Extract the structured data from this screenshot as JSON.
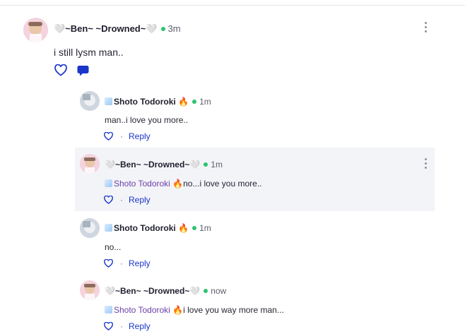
{
  "post": {
    "author": "🤍~Ben~ ~Drowned~🤍",
    "time": "3m",
    "text": "i still lysm man.."
  },
  "replies": [
    {
      "author": "Shoto Todoroki",
      "emoji": "🔥",
      "time": "1m",
      "mention": "",
      "text": "man..i love you more..",
      "reply_label": "Reply"
    },
    {
      "author": "🤍~Ben~ ~Drowned~🤍",
      "emoji": "",
      "time": "1m",
      "mention": "Shoto Todoroki 🔥",
      "text": "no...i love you more..",
      "reply_label": "Reply"
    },
    {
      "author": "Shoto Todoroki",
      "emoji": "🔥",
      "time": "1m",
      "mention": "",
      "text": "no...",
      "reply_label": "Reply"
    },
    {
      "author": "🤍~Ben~ ~Drowned~🤍",
      "emoji": "",
      "time": "now",
      "mention": "Shoto Todoroki 🔥",
      "text": "i love you way more man...",
      "reply_label": "Reply"
    }
  ],
  "icons": {
    "like": "heart-outline-icon",
    "comment": "chat-bubble-icon",
    "more": "kebab-menu-icon"
  },
  "colors": {
    "online": "#2bc46d",
    "link": "#1a35c9",
    "mention": "#6b3fa8",
    "highlight": "#f3f4f8"
  }
}
